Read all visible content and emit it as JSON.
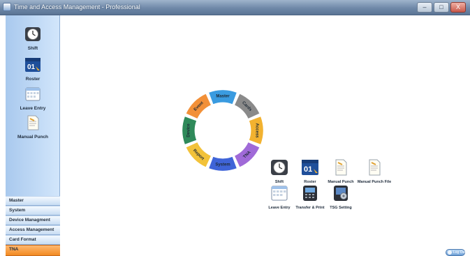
{
  "window": {
    "title": "Time and Access Management - Professional",
    "controls": {
      "minimize": "–",
      "restore": "□",
      "close": "X"
    }
  },
  "sidebar": {
    "items": [
      {
        "label": "Shift",
        "icon": "clock-icon"
      },
      {
        "label": "Roster",
        "icon": "calendar-icon",
        "calendar_text": "01"
      },
      {
        "label": "Leave Entry",
        "icon": "calendar-grid-icon"
      },
      {
        "label": "Manual Punch",
        "icon": "document-icon"
      }
    ]
  },
  "nav": {
    "items": [
      "Master",
      "System",
      "Device Managment",
      "Access Management",
      "Card Format",
      "TNA"
    ],
    "active": "TNA",
    "active_color": "#f28a22"
  },
  "ring": {
    "segments": [
      {
        "label": "Master",
        "color": "#3a9be0"
      },
      {
        "label": "Cards",
        "color": "#8a8a8a"
      },
      {
        "label": "Access",
        "color": "#f2b230"
      },
      {
        "label": "TNA",
        "color": "#a06ad8"
      },
      {
        "label": "System",
        "color": "#3f64d8"
      },
      {
        "label": "Report",
        "color": "#f2c23a"
      },
      {
        "label": "Device",
        "color": "#2f8a5a"
      },
      {
        "label": "Event",
        "color": "#f29038"
      }
    ]
  },
  "apps": [
    {
      "label": "Shift",
      "icon": "clock-icon"
    },
    {
      "label": "Roster",
      "icon": "calendar-icon",
      "calendar_text": "01"
    },
    {
      "label": "Manual Punch",
      "icon": "document-icon"
    },
    {
      "label": "Manual Punch File",
      "icon": "document-icon"
    },
    {
      "label": "Leave Entry",
      "icon": "calendar-grid-icon"
    },
    {
      "label": "Transfer & Print",
      "icon": "terminal-icon"
    },
    {
      "label": "TSG Setting",
      "icon": "settings-icon"
    }
  ],
  "logout": {
    "label": "Log Out"
  }
}
